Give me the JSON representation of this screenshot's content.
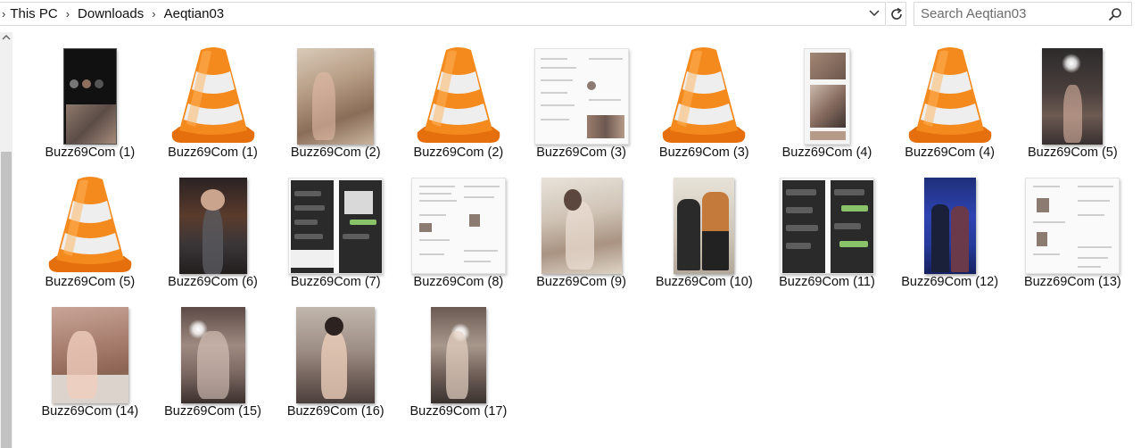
{
  "address": {
    "breadcrumb": [
      "This PC",
      "Downloads",
      "Aeqtian03"
    ]
  },
  "search": {
    "placeholder": "Search Aeqtian03"
  },
  "files": [
    {
      "name": "Buzz69Com (1)",
      "kind": "phone-screenshot"
    },
    {
      "name": "Buzz69Com (1)",
      "kind": "vlc-icon"
    },
    {
      "name": "Buzz69Com (2)",
      "kind": "photo"
    },
    {
      "name": "Buzz69Com (2)",
      "kind": "vlc-icon"
    },
    {
      "name": "Buzz69Com (3)",
      "kind": "chat-screenshot"
    },
    {
      "name": "Buzz69Com (3)",
      "kind": "vlc-icon"
    },
    {
      "name": "Buzz69Com (4)",
      "kind": "photo"
    },
    {
      "name": "Buzz69Com (4)",
      "kind": "vlc-icon"
    },
    {
      "name": "Buzz69Com (5)",
      "kind": "photo"
    },
    {
      "name": "Buzz69Com (5)",
      "kind": "vlc-icon"
    },
    {
      "name": "Buzz69Com (6)",
      "kind": "photo"
    },
    {
      "name": "Buzz69Com (7)",
      "kind": "chat-screenshot-dark"
    },
    {
      "name": "Buzz69Com (8)",
      "kind": "chat-screenshot"
    },
    {
      "name": "Buzz69Com (9)",
      "kind": "photo"
    },
    {
      "name": "Buzz69Com (10)",
      "kind": "photo"
    },
    {
      "name": "Buzz69Com (11)",
      "kind": "chat-screenshot-dark"
    },
    {
      "name": "Buzz69Com (12)",
      "kind": "photo"
    },
    {
      "name": "Buzz69Com (13)",
      "kind": "chat-screenshot"
    },
    {
      "name": "Buzz69Com (14)",
      "kind": "photo"
    },
    {
      "name": "Buzz69Com (15)",
      "kind": "photo"
    },
    {
      "name": "Buzz69Com (16)",
      "kind": "photo"
    },
    {
      "name": "Buzz69Com (17)",
      "kind": "photo"
    }
  ],
  "icons": {
    "breadcrumb_separator": "chevron-right-icon",
    "address_dropdown": "chevron-down-icon",
    "refresh": "refresh-icon",
    "search": "search-icon",
    "scroll_up": "scroll-up-arrow-icon",
    "video_file": "vlc-cone-icon"
  },
  "colors": {
    "vlc_orange": "#f28a1b",
    "border": "#d9d9d9"
  }
}
